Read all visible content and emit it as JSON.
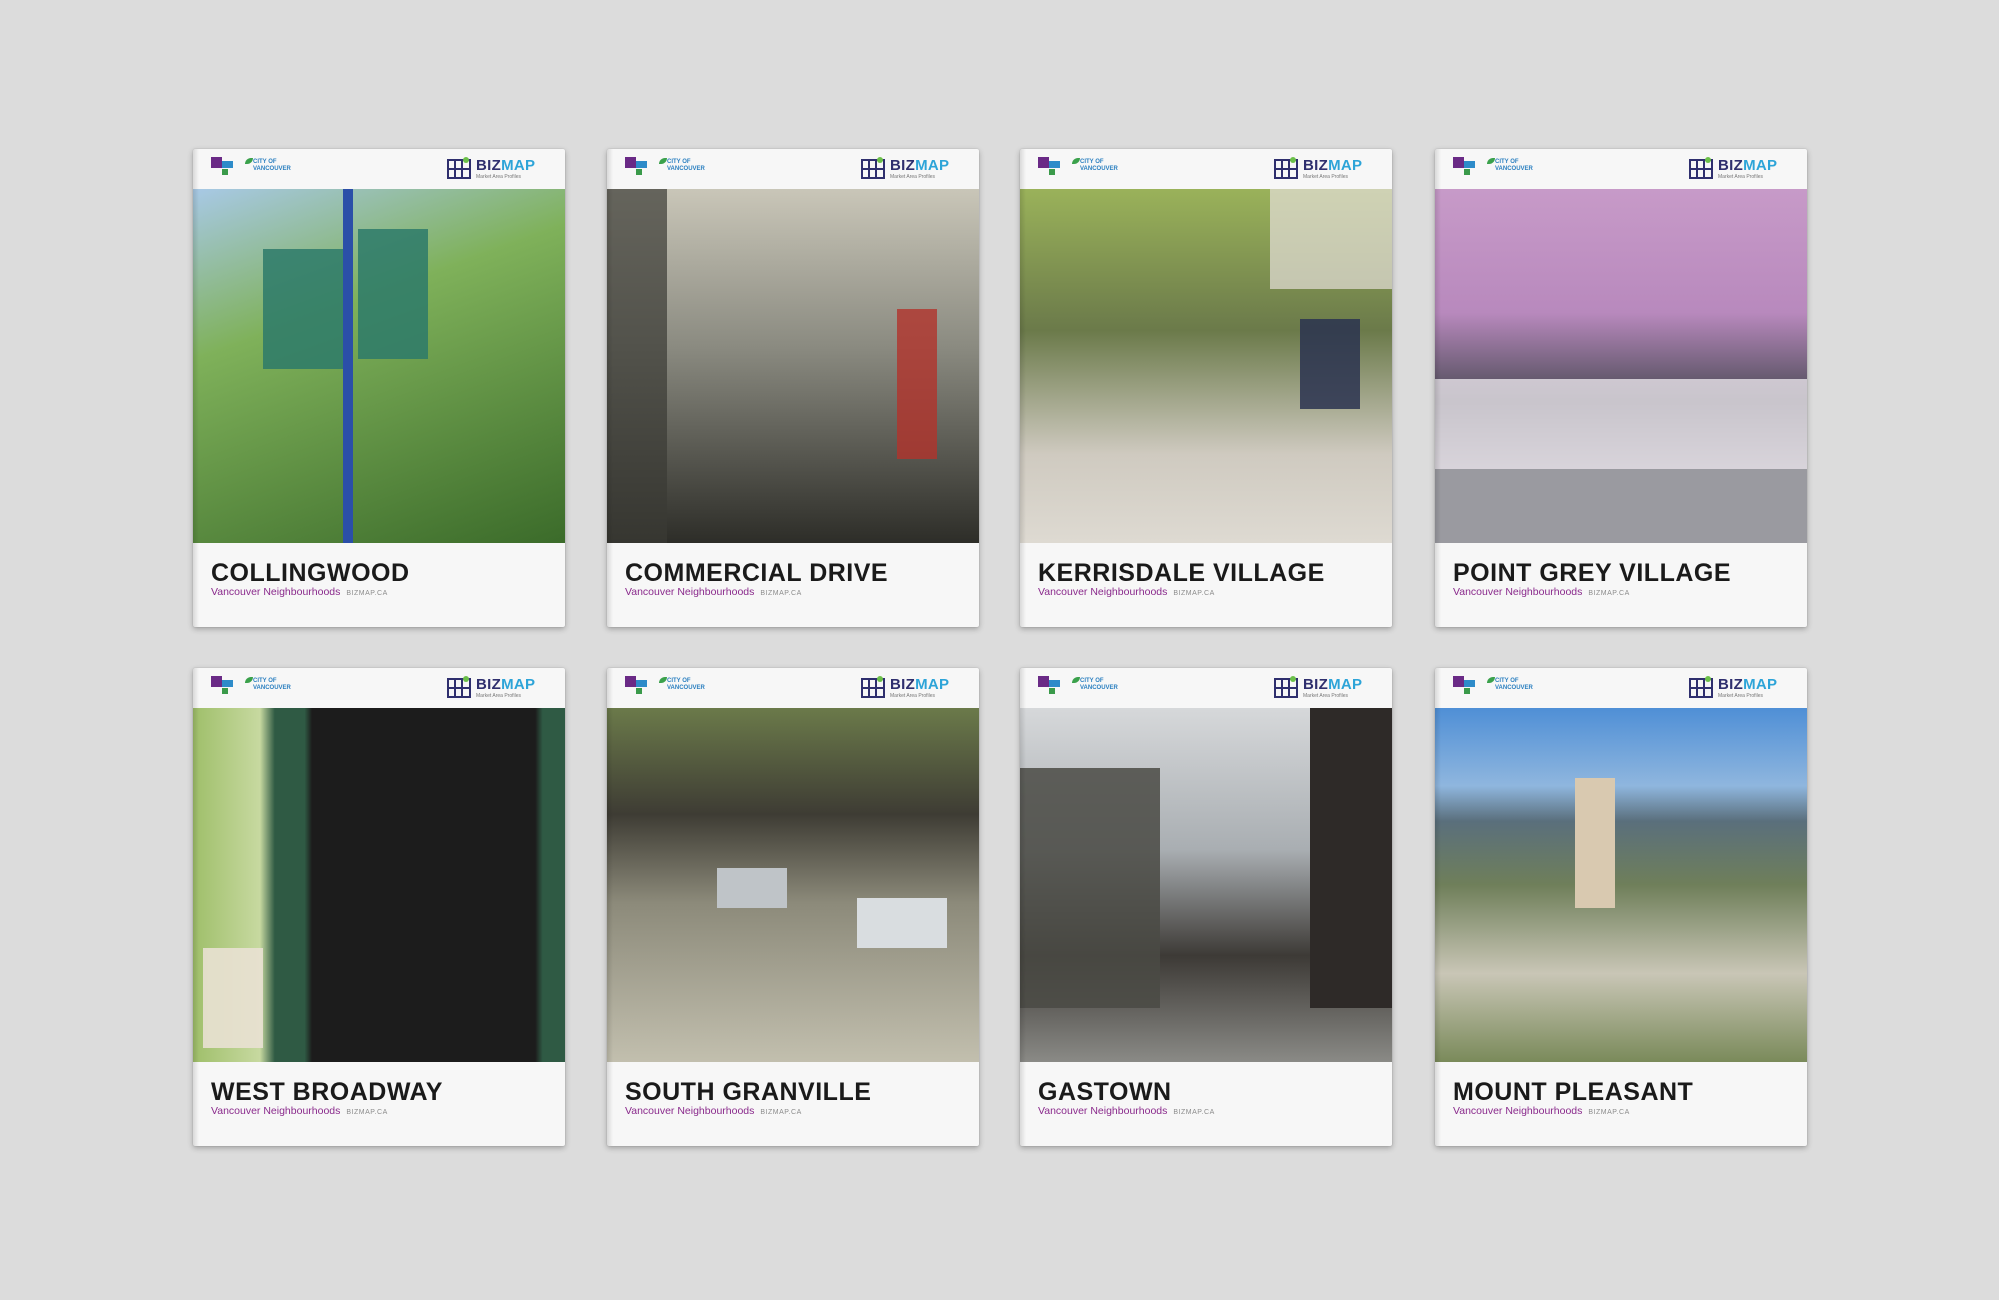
{
  "branding": {
    "partner_line1": "CITY OF",
    "partner_line2": "VANCOUVER",
    "bizmap_biz": "BIZ",
    "bizmap_map": "MAP",
    "bizmap_tagline": "Market Area Profiles"
  },
  "booklets": [
    {
      "title": "COLLINGWOOD",
      "subtitle": "Vancouver Neighbourhoods",
      "site": "BIZMAP.CA",
      "photo_colors": [
        "#7fb15a",
        "#3b6b2a",
        "#a8c9e6"
      ]
    },
    {
      "title": "COMMERCIAL DRIVE",
      "subtitle": "Vancouver Neighbourhoods",
      "site": "BIZMAP.CA",
      "photo_colors": [
        "#8a8a80",
        "#2d2d28",
        "#c9c6b8"
      ]
    },
    {
      "title": "KERRISDALE VILLAGE",
      "subtitle": "Vancouver Neighbourhoods",
      "site": "BIZMAP.CA",
      "photo_colors": [
        "#9ab25a",
        "#cfcac0",
        "#6b7a4a"
      ]
    },
    {
      "title": "POINT GREY VILLAGE",
      "subtitle": "Vancouver Neighbourhoods",
      "site": "BIZMAP.CA",
      "photo_colors": [
        "#c79ac8",
        "#4a4a55",
        "#e8e4ea"
      ]
    },
    {
      "title": "WEST BROADWAY",
      "subtitle": "Vancouver Neighbourhoods",
      "site": "BIZMAP.CA",
      "photo_colors": [
        "#2f5a44",
        "#1c1c1c",
        "#9fbf6a"
      ]
    },
    {
      "title": "SOUTH GRANVILLE",
      "subtitle": "Vancouver Neighbourhoods",
      "site": "BIZMAP.CA",
      "photo_colors": [
        "#8c8a7a",
        "#3e3c34",
        "#c2bfae"
      ]
    },
    {
      "title": "GASTOWN",
      "subtitle": "Vancouver Neighbourhoods",
      "site": "BIZMAP.CA",
      "photo_colors": [
        "#a9aeb2",
        "#3d3a36",
        "#d6d8da"
      ]
    },
    {
      "title": "MOUNT PLEASANT",
      "subtitle": "Vancouver Neighbourhoods",
      "site": "BIZMAP.CA",
      "photo_colors": [
        "#4f8fd6",
        "#6f7f5a",
        "#c9d6e2"
      ]
    }
  ]
}
